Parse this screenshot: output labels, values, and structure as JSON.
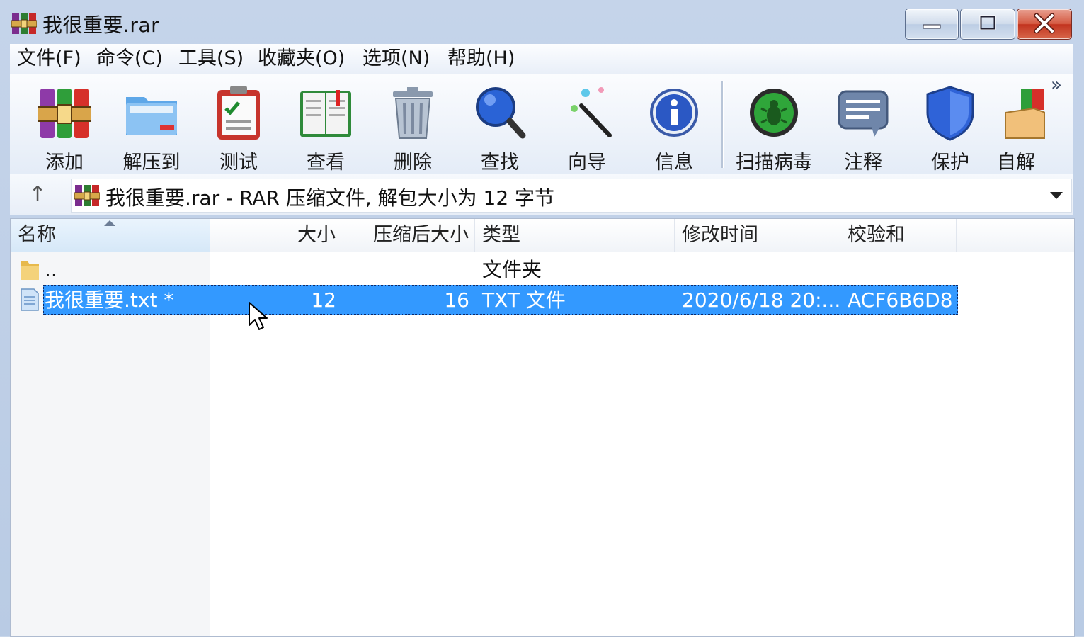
{
  "window": {
    "title": "我很重要.rar"
  },
  "menu": [
    "文件(F)",
    "命令(C)",
    "工具(S)",
    "收藏夹(O)",
    "选项(N)",
    "帮助(H)"
  ],
  "toolbar": [
    {
      "label": "添加",
      "icon": "add-archive-icon"
    },
    {
      "label": "解压到",
      "icon": "extract-folder-icon"
    },
    {
      "label": "测试",
      "icon": "test-clipboard-icon"
    },
    {
      "label": "查看",
      "icon": "view-book-icon"
    },
    {
      "label": "删除",
      "icon": "trash-can-icon"
    },
    {
      "label": "查找",
      "icon": "magnifier-icon"
    },
    {
      "label": "向导",
      "icon": "magic-wand-icon"
    },
    {
      "label": "信息",
      "icon": "info-icon"
    },
    {
      "label": "扫描病毒",
      "icon": "virus-scan-icon"
    },
    {
      "label": "注释",
      "icon": "comment-icon"
    },
    {
      "label": "保护",
      "icon": "shield-icon"
    },
    {
      "label": "自解",
      "icon": "sfx-box-icon"
    }
  ],
  "address": {
    "text": "我很重要.rar - RAR 压缩文件, 解包大小为 12 字节"
  },
  "columns": [
    "名称",
    "大小",
    "压缩后大小",
    "类型",
    "修改时间",
    "校验和"
  ],
  "rows": [
    {
      "name": "..",
      "size": "",
      "packed": "",
      "type": "文件夹",
      "modified": "",
      "crc": ""
    },
    {
      "name": "我很重要.txt *",
      "size": "12",
      "packed": "16",
      "type": "TXT 文件",
      "modified": "2020/6/18 20:...",
      "crc": "ACF6B6D8"
    }
  ],
  "colors": {
    "selection": "#3399ff",
    "close_button": "#c2341f"
  }
}
